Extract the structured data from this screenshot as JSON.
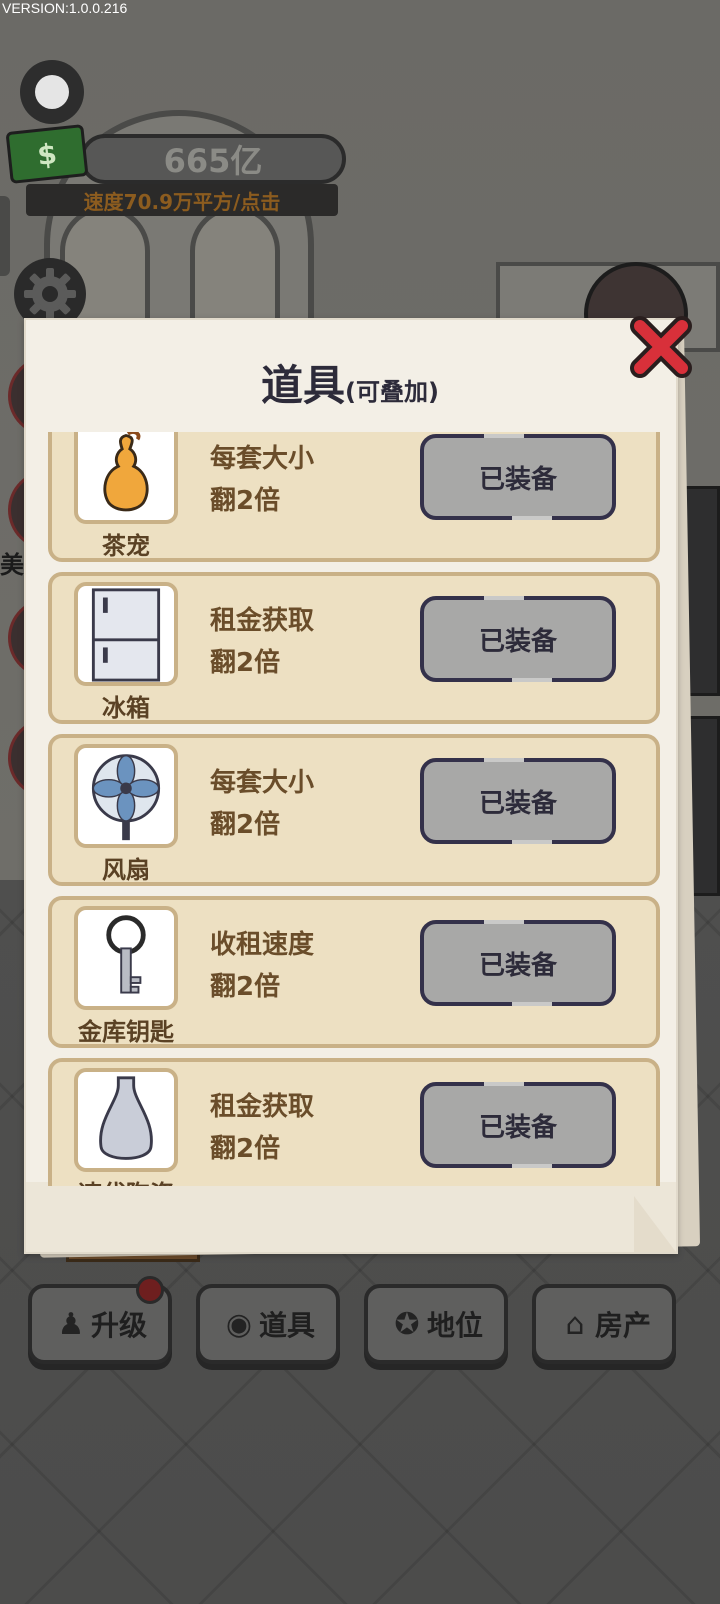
{
  "version": "VERSION:1.0.0.216",
  "hud": {
    "money": "665亿",
    "speed": "速度70.9万平方/点击",
    "side_label": "美"
  },
  "modal": {
    "title": "道具",
    "subtitle": "(可叠加)",
    "items": [
      {
        "icon": "gourd-icon",
        "name": "茶宠",
        "effect_line1": "每套大小",
        "effect_line2": "翻2倍",
        "button": "已装备"
      },
      {
        "icon": "fridge-icon",
        "name": "冰箱",
        "effect_line1": "租金获取",
        "effect_line2": "翻2倍",
        "button": "已装备"
      },
      {
        "icon": "fan-icon",
        "name": "风扇",
        "effect_line1": "每套大小",
        "effect_line2": "翻2倍",
        "button": "已装备"
      },
      {
        "icon": "key-icon",
        "name": "金库钥匙",
        "effect_line1": "收租速度",
        "effect_line2": "翻2倍",
        "button": "已装备"
      },
      {
        "icon": "vase-icon",
        "name": "速代陶瓷",
        "effect_line1": "租金获取",
        "effect_line2": "翻2倍",
        "button": "已装备"
      }
    ]
  },
  "nav": {
    "upgrade": "升级",
    "props": "道具",
    "status": "地位",
    "property": "房产"
  },
  "colors": {
    "card_bg": "#ede0c2",
    "card_border": "#c9b187",
    "button_bg": "#a8a8a7",
    "close_red": "#d8303a"
  }
}
